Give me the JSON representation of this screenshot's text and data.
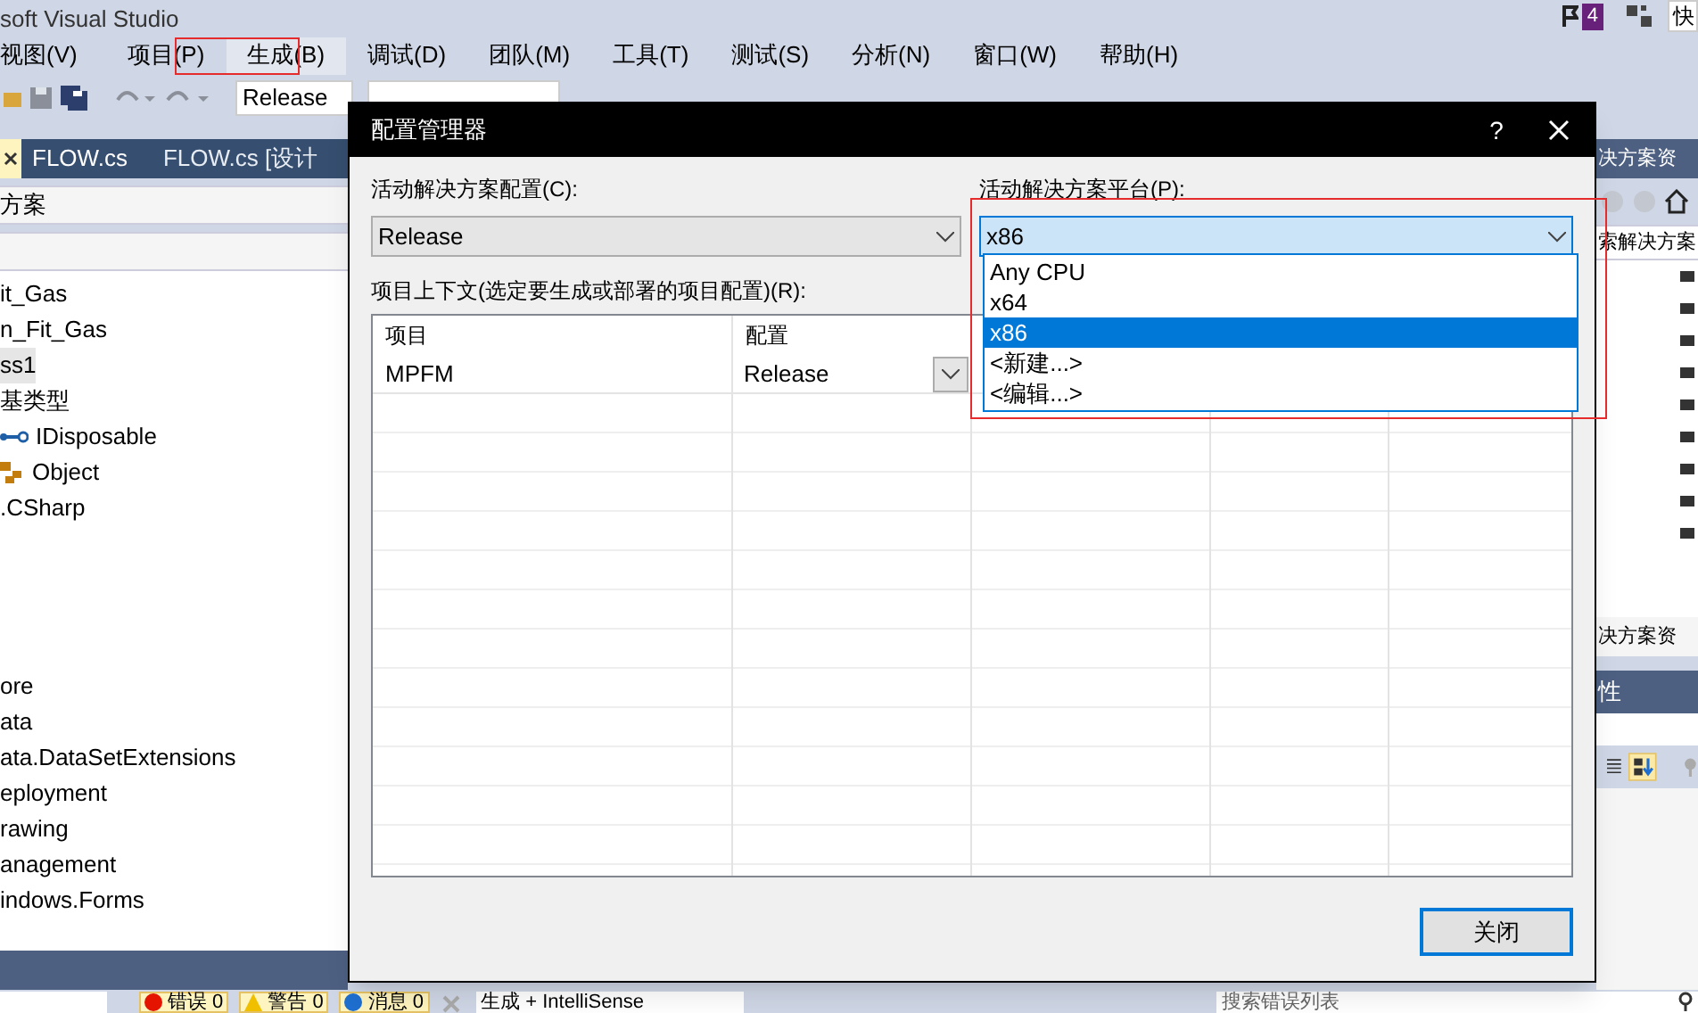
{
  "app_title": "soft Visual Studio",
  "notification_count": "4",
  "quick_launch": "快",
  "menu": [
    {
      "label": "视图(V)",
      "highlighted": false
    },
    {
      "label": "项目(P)",
      "highlighted": false
    },
    {
      "label": "生成(B)",
      "highlighted": true
    },
    {
      "label": "调试(D)",
      "highlighted": false
    },
    {
      "label": "团队(M)",
      "highlighted": false
    },
    {
      "label": "工具(T)",
      "highlighted": false
    },
    {
      "label": "测试(S)",
      "highlighted": false
    },
    {
      "label": "分析(N)",
      "highlighted": false
    },
    {
      "label": "窗口(W)",
      "highlighted": false
    },
    {
      "label": "帮助(H)",
      "highlighted": false
    }
  ],
  "toolbar": {
    "configuration": "Release"
  },
  "document_tabs": [
    {
      "label": "FLOW.cs",
      "selected": true
    },
    {
      "label": "FLOW.cs [设计",
      "selected": false
    }
  ],
  "class_view": {
    "search": "方案",
    "items": [
      {
        "label": "it_Gas",
        "kind": "plain",
        "selected": false
      },
      {
        "label": "n_Fit_Gas",
        "kind": "plain",
        "selected": false
      },
      {
        "label": "ss1",
        "kind": "plain",
        "selected": true
      },
      {
        "label": "基类型",
        "kind": "plain",
        "selected": false,
        "children": [
          {
            "label": "IDisposable",
            "kind": "interface",
            "selected": false
          },
          {
            "label": "Object",
            "kind": "class",
            "selected": false
          }
        ]
      },
      {
        "label": ".CSharp",
        "kind": "plain",
        "selected": false
      },
      {
        "kind": "gap"
      },
      {
        "label": "ore",
        "kind": "plain",
        "selected": false
      },
      {
        "label": "ata",
        "kind": "plain",
        "selected": false
      },
      {
        "label": "ata.DataSetExtensions",
        "kind": "plain",
        "selected": false
      },
      {
        "label": "eployment",
        "kind": "plain",
        "selected": false
      },
      {
        "label": "rawing",
        "kind": "plain",
        "selected": false
      },
      {
        "label": "anagement",
        "kind": "plain",
        "selected": false
      },
      {
        "label": "indows.Forms",
        "kind": "plain",
        "selected": false
      }
    ]
  },
  "dialog": {
    "title": "配置管理器",
    "help": "?",
    "config_label": "活动解决方案配置(C):",
    "config_value": "Release",
    "platform_label": "活动解决方案平台(P):",
    "platform_value": "x86",
    "platform_highlighted": true,
    "platform_options": [
      {
        "label": "Any CPU",
        "selected": false
      },
      {
        "label": "x64",
        "selected": false
      },
      {
        "label": "x86",
        "selected": true
      },
      {
        "label": "<新建...>",
        "selected": false
      },
      {
        "label": "<编辑...>",
        "selected": false
      }
    ],
    "context_label": "项目上下文(选定要生成或部署的项目配置)(R):",
    "columns": [
      "项目",
      "配置"
    ],
    "rows": [
      {
        "project": "MPFM",
        "configuration": "Release"
      }
    ],
    "close_button": "关闭"
  },
  "solution_explorer": {
    "title": "决方案资",
    "search": "索解决方案",
    "tab": "决方案资"
  },
  "properties": {
    "title": "性"
  },
  "error_list": {
    "errors": "错误 0",
    "warnings": "警告 0",
    "messages": "消息 0",
    "scope": "生成 + IntelliSense",
    "search": "搜索错误列表"
  }
}
